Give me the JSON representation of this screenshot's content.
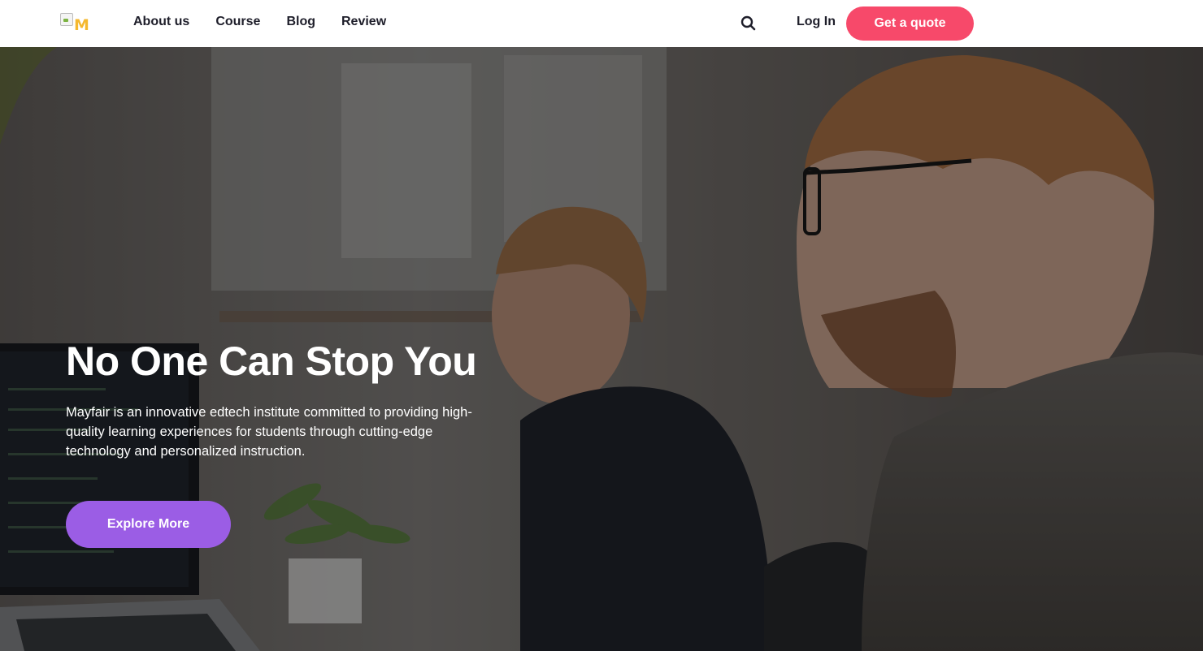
{
  "brand": {
    "logo_text": "M",
    "logo_color": "#f5b82e"
  },
  "nav": {
    "links": [
      {
        "label": "About us"
      },
      {
        "label": "Course"
      },
      {
        "label": "Blog"
      },
      {
        "label": "Review"
      }
    ],
    "search_icon": "search-icon",
    "login_label": "Log In",
    "quote_label": "Get a quote"
  },
  "hero": {
    "title": "No One Can Stop You",
    "description": "Mayfair is an innovative edtech institute committed to providing high-quality learning experiences for students through cutting-edge technology and personalized instruction.",
    "cta_label": "Explore More"
  },
  "colors": {
    "accent_pink": "#f7496a",
    "accent_purple": "#9b5de5",
    "text_dark": "#1e1e2a"
  }
}
